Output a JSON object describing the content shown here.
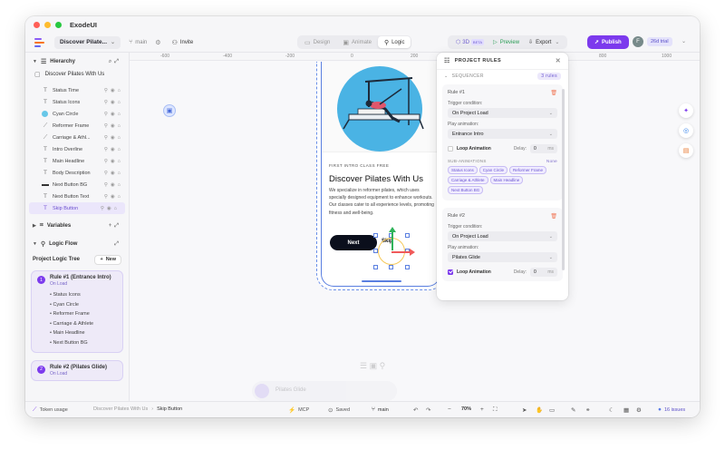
{
  "app": {
    "name": "ExodeUI"
  },
  "toolbar": {
    "project": "Discover Pilate...",
    "branch": "main",
    "invite": "Invite",
    "modes": [
      "Design",
      "Animate",
      "Logic"
    ],
    "three_d": "3D",
    "beta": "BETA",
    "preview": "Preview",
    "export": "Export",
    "publish": "Publish",
    "avatar_initial": "F",
    "trial": "26d trial"
  },
  "sidebar": {
    "hierarchy": "Hierarchy",
    "page": "Discover Pilates With Us",
    "layers": [
      "Status Time",
      "Status Icons",
      "Cyan Circle",
      "Reformer Frame",
      "Carriage & Athl...",
      "Intro Overline",
      "Main Headline",
      "Body Description",
      "Next Button BG",
      "Next Button Text",
      "Skip Button"
    ],
    "variables": "Variables",
    "logic_flow": "Logic Flow",
    "logic_tree": "Project Logic Tree",
    "new_btn": "New",
    "rule1": {
      "num": "1",
      "title": "Rule #1 (Entrance Intro)",
      "sub": "On Load",
      "items": [
        "• Status Icons",
        "• Cyan Circle",
        "• Reformer Frame",
        "• Carriage & Athlete",
        "• Main Headline",
        "• Next Button BG"
      ]
    },
    "rule2": {
      "num": "2",
      "title": "Rule #2 (Pilates Glide)",
      "sub": "On Load"
    }
  },
  "canvas": {
    "ruler": [
      "-600",
      "-400",
      "-200",
      "0",
      "200",
      "400",
      "600",
      "800",
      "1000"
    ],
    "phone": {
      "overline": "FIRST INTRO CLASS FREE",
      "headline": "Discover Pilates With Us",
      "body": "We specialize in reformer pilates, which uses specially designed equipment to enhance workouts. Our classes cater to all experience levels, promoting fitness and well-being.",
      "next": "Next",
      "skip": "Skip"
    },
    "ghost": {
      "anim_name": "Pilates Glide"
    }
  },
  "rules_panel": {
    "title": "PROJECT RULES",
    "sequencer": "SEQUENCER",
    "count": "3 rules",
    "rule1": {
      "title": "Rule #1",
      "trigger_label": "Trigger condition:",
      "trigger": "On Project Load",
      "anim_label": "Play animation:",
      "anim": "Entrance Intro",
      "loop": "Loop Animation",
      "delay_label": "Delay:",
      "delay": "0",
      "unit": "ms",
      "sub_label": "SUB-ANIMATIONS",
      "none": "None",
      "chips": [
        "Status Icons",
        "Cyan Circle",
        "Reformer Frame",
        "Carriage & Athlete",
        "Main Headline",
        "Next Button BG"
      ]
    },
    "rule2": {
      "title": "Rule #2",
      "trigger_label": "Trigger condition:",
      "trigger": "On Project Load",
      "anim_label": "Play animation:",
      "anim": "Pilates Glide",
      "loop": "Loop Animation",
      "delay_label": "Delay:",
      "delay": "0",
      "unit": "ms"
    }
  },
  "status": {
    "token": "Token usage",
    "crumb1": "Discover Pilates With Us",
    "crumb2": "Skip Button",
    "mcp": "MCP",
    "saved": "Saved",
    "branch": "main",
    "zoom": "70%",
    "issues": "16 issues"
  },
  "colors": {
    "accent": "#7c3aed",
    "cyan": "#4ab3e4",
    "selection": "#5a7fe0"
  }
}
